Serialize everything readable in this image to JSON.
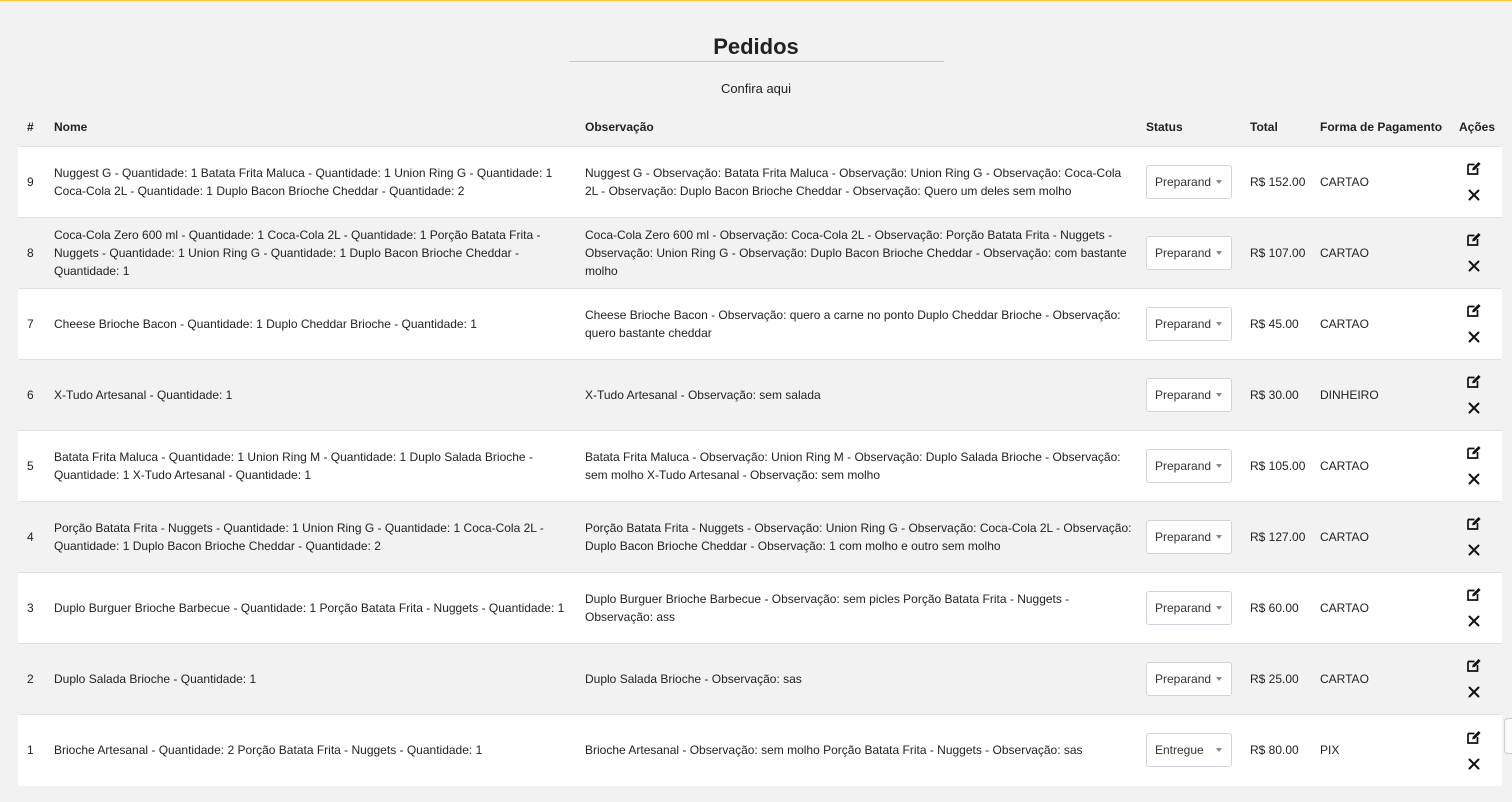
{
  "header": {
    "title": "Pedidos",
    "subtitle": "Confira aqui"
  },
  "table": {
    "columns": [
      "#",
      "Nome",
      "Observação",
      "Status",
      "Total",
      "Forma de Pagamento",
      "Ações"
    ],
    "rows": [
      {
        "id": "9",
        "nome": "Nuggest G - Quantidade: 1 Batata Frita Maluca - Quantidade: 1 Union Ring G - Quantidade: 1 Coca-Cola 2L - Quantidade: 1 Duplo Bacon Brioche Cheddar - Quantidade: 2",
        "obs": "Nuggest G - Observação: Batata Frita Maluca - Observação: Union Ring G - Observação: Coca-Cola 2L - Observação: Duplo Bacon Brioche Cheddar - Observação: Quero um deles sem molho",
        "status": "Preparand",
        "total": "R$ 152.00",
        "pagamento": "CARTAO"
      },
      {
        "id": "8",
        "nome": "Coca-Cola Zero 600 ml - Quantidade: 1 Coca-Cola 2L - Quantidade: 1 Porção Batata Frita - Nuggets - Quantidade: 1 Union Ring G - Quantidade: 1 Duplo Bacon Brioche Cheddar - Quantidade: 1",
        "obs": "Coca-Cola Zero 600 ml - Observação: Coca-Cola 2L - Observação: Porção Batata Frita - Nuggets - Observação: Union Ring G - Observação: Duplo Bacon Brioche Cheddar - Observação: com bastante molho",
        "status": "Preparand",
        "total": "R$ 107.00",
        "pagamento": "CARTAO"
      },
      {
        "id": "7",
        "nome": "Cheese Brioche Bacon - Quantidade: 1 Duplo Cheddar Brioche - Quantidade: 1",
        "obs": "Cheese Brioche Bacon - Observação: quero a carne no ponto Duplo Cheddar Brioche - Observação: quero bastante cheddar",
        "status": "Preparand",
        "total": "R$ 45.00",
        "pagamento": "CARTAO"
      },
      {
        "id": "6",
        "nome": "X-Tudo Artesanal - Quantidade: 1",
        "obs": "X-Tudo Artesanal - Observação: sem salada",
        "status": "Preparand",
        "total": "R$ 30.00",
        "pagamento": "DINHEIRO"
      },
      {
        "id": "5",
        "nome": "Batata Frita Maluca - Quantidade: 1 Union Ring M - Quantidade: 1 Duplo Salada Brioche - Quantidade: 1 X-Tudo Artesanal - Quantidade: 1",
        "obs": "Batata Frita Maluca - Observação: Union Ring M - Observação: Duplo Salada Brioche - Observação: sem molho X-Tudo Artesanal - Observação: sem molho",
        "status": "Preparand",
        "total": "R$ 105.00",
        "pagamento": "CARTAO"
      },
      {
        "id": "4",
        "nome": "Porção Batata Frita - Nuggets - Quantidade: 1 Union Ring G - Quantidade: 1 Coca-Cola 2L - Quantidade: 1 Duplo Bacon Brioche Cheddar - Quantidade: 2",
        "obs": "Porção Batata Frita - Nuggets - Observação: Union Ring G - Observação: Coca-Cola 2L - Observação: Duplo Bacon Brioche Cheddar - Observação: 1 com molho e outro sem molho",
        "status": "Preparand",
        "total": "R$ 127.00",
        "pagamento": "CARTAO"
      },
      {
        "id": "3",
        "nome": "Duplo Burguer Brioche Barbecue - Quantidade: 1 Porção Batata Frita - Nuggets - Quantidade: 1",
        "obs": "Duplo Burguer Brioche Barbecue - Observação: sem picles Porção Batata Frita - Nuggets - Observação: ass",
        "status": "Preparand",
        "total": "R$ 60.00",
        "pagamento": "CARTAO"
      },
      {
        "id": "2",
        "nome": "Duplo Salada Brioche - Quantidade: 1",
        "obs": "Duplo Salada Brioche - Observação: sas",
        "status": "Preparand",
        "total": "R$ 25.00",
        "pagamento": "CARTAO"
      },
      {
        "id": "1",
        "nome": "Brioche Artesanal - Quantidade: 2 Porção Batata Frita - Nuggets - Quantidade: 1",
        "obs": "Brioche Artesanal - Observação: sem molho Porção Batata Frita - Nuggets - Observação: sas",
        "status": "Entregue",
        "total": "R$ 80.00",
        "pagamento": "PIX"
      }
    ]
  },
  "icons": {
    "edit": "edit-icon",
    "delete": "close-icon"
  },
  "colors": {
    "accent": "#f2c94c",
    "row_alt": "#f2f2f2",
    "row": "#ffffff"
  }
}
